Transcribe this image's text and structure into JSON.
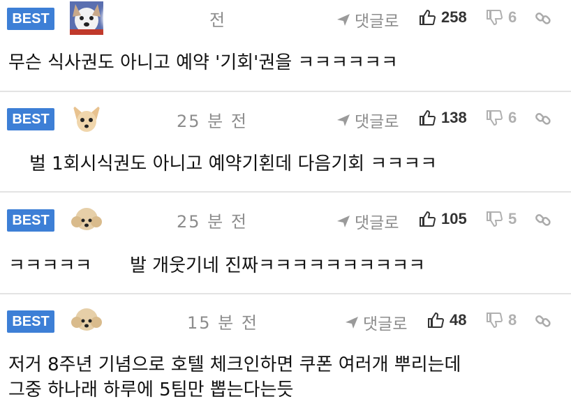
{
  "comments": [
    {
      "badge": "BEST",
      "time": "전",
      "reply": "댓글로",
      "likes": "258",
      "dislikes": "6",
      "text": "무슨 식사권도 아니고 예약 '기회'권을 ㅋㅋㅋㅋㅋㅋ",
      "avatar": "white-dog-avatar"
    },
    {
      "badge": "BEST",
      "time": "25 분 전",
      "reply": "댓글로",
      "likes": "138",
      "dislikes": "6",
      "text": "벌 1회시식권도 아니고 예약기횐데 다음기회 ㅋㅋㅋㅋ",
      "avatar": "chihuahua-avatar"
    },
    {
      "badge": "BEST",
      "time": "25 분 전",
      "reply": "댓글로",
      "likes": "105",
      "dislikes": "5",
      "text_a": "ㅋㅋㅋㅋㅋ",
      "text_b": "발 개웃기네 진짜ㅋㅋㅋㅋㅋㅋㅋㅋㅋㅋ",
      "avatar": "poodle-avatar"
    },
    {
      "badge": "BEST",
      "time": "15 분 전",
      "reply": "댓글로",
      "likes": "48",
      "dislikes": "8",
      "text_line1": "저거 8주년 기념으로 호텔 체크인하면 쿠폰 여러개 뿌리는데",
      "text_line2": "그중 하나래 하루에 5팀만 뽑는다는듯",
      "avatar": "poodle-avatar"
    }
  ],
  "colors": {
    "badge": "#3d7fd6",
    "muted": "#8c8c8c",
    "divider": "#e3e3e3"
  }
}
